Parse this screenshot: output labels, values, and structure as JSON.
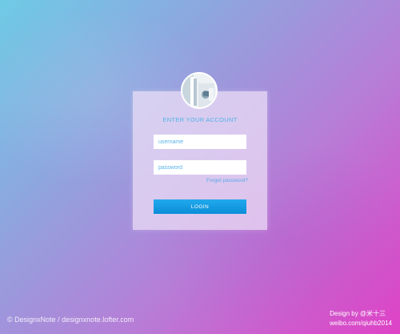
{
  "login": {
    "title": "ENTER YOUR ACCOUNT",
    "username_placeholder": "username",
    "password_placeholder": "password",
    "forgot_label": "Forget password?",
    "login_label": "LOGIN"
  },
  "footer": {
    "watermark": "© DesignxNote / designxnote.lofter.com",
    "credit_line1": "Design by @米十三",
    "credit_line2": "weibo.com/qiuhb2014"
  },
  "colors": {
    "accent": "#4fb3e6",
    "button": "#0a8ed8",
    "gradient_start": "#6ecbe6",
    "gradient_end": "#de42c6"
  },
  "icons": {
    "avatar": "door-photo-avatar"
  }
}
